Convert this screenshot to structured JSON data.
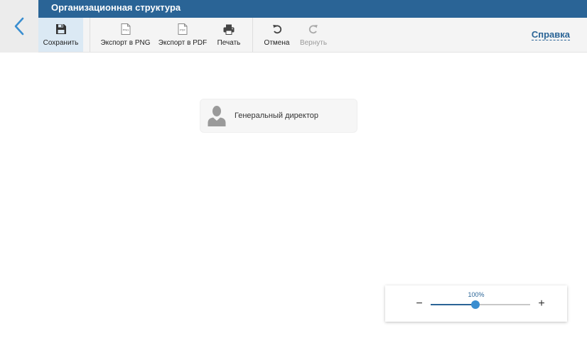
{
  "header": {
    "title": "Организационная структура",
    "back_icon": "chevron-left-icon"
  },
  "toolbar": {
    "save": {
      "label": "Сохранить",
      "icon": "floppy-disk-icon",
      "active": true
    },
    "export_png": {
      "label": "Экспорт в PNG",
      "icon": "png-file-icon",
      "icon_text": "PNG"
    },
    "export_pdf": {
      "label": "Экспорт в PDF",
      "icon": "pdf-file-icon",
      "icon_text": "PDF"
    },
    "print": {
      "label": "Печать",
      "icon": "printer-icon"
    },
    "undo": {
      "label": "Отмена",
      "icon": "undo-icon"
    },
    "redo": {
      "label": "Вернуть",
      "icon": "redo-icon",
      "disabled": true
    },
    "help_label": "Справка"
  },
  "org_chart": {
    "nodes": [
      {
        "title": "Генеральный директор",
        "icon": "person-icon"
      }
    ]
  },
  "zoom": {
    "value_text": "100%",
    "level_fraction": 0.45,
    "minus_label": "−",
    "plus_label": "+"
  },
  "colors": {
    "brand": "#2a6496",
    "accent": "#3a8ed0",
    "toolbar_bg": "#f4f4f4",
    "active_tool_bg": "#dbe9f4"
  }
}
